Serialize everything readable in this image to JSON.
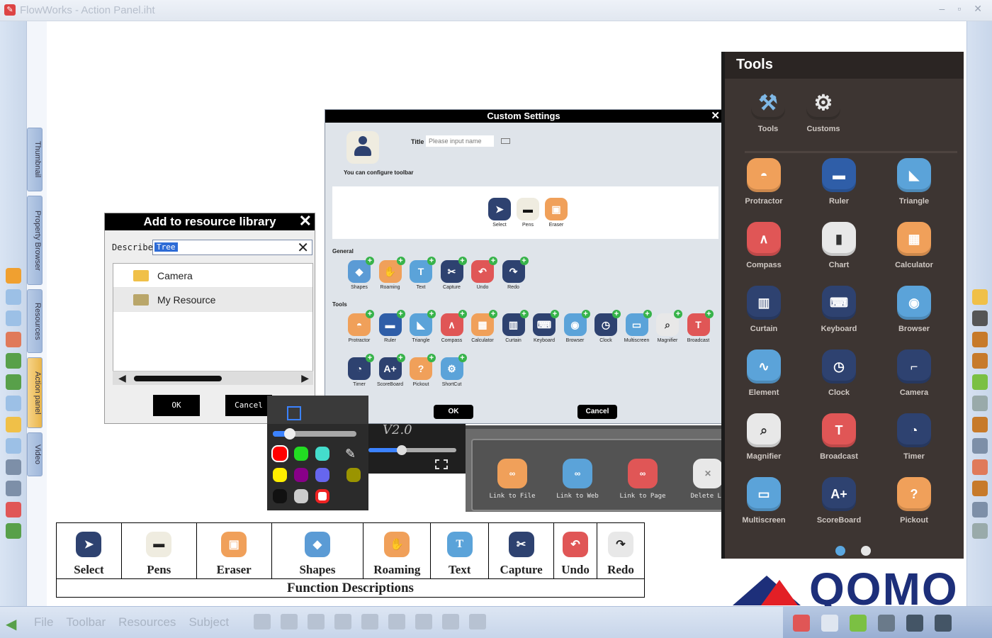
{
  "window": {
    "title": "FlowWorks - Action Panel.iht"
  },
  "left_tabs": [
    "Thumbnail",
    "Property Browser",
    "Resources",
    "Action panel",
    "Video"
  ],
  "bottom_menu": [
    "File",
    "Toolbar",
    "Resources",
    "Subject"
  ],
  "resource_dialog": {
    "title": "Add to resource library",
    "describe_label": "Describe",
    "describe_value": "Tree",
    "items": [
      "Camera",
      "My Resource"
    ],
    "ok": "OK",
    "cancel": "Cancel"
  },
  "custom_settings": {
    "title": "Custom Settings",
    "title_label": "Title",
    "title_placeholder": "Please input name",
    "hint": "You can configure toolbar",
    "preview": [
      {
        "label": "Select",
        "icon": "select-icon",
        "color": "#2e4270"
      },
      {
        "label": "Pens",
        "icon": "pens-icon",
        "color": "#efece0"
      },
      {
        "label": "Eraser",
        "icon": "eraser-icon",
        "color": "#f0a05a"
      }
    ],
    "general_label": "General",
    "general": [
      {
        "label": "Shapes",
        "icon": "shapes-icon",
        "color": "#5b9bd5"
      },
      {
        "label": "Roaming",
        "icon": "roaming-icon",
        "color": "#f0a05a"
      },
      {
        "label": "Text",
        "icon": "text-icon",
        "color": "#5ba3d9"
      },
      {
        "label": "Capture",
        "icon": "capture-icon",
        "color": "#2e4270"
      },
      {
        "label": "Undo",
        "icon": "undo-icon",
        "color": "#e05656"
      },
      {
        "label": "Redo",
        "icon": "redo-icon",
        "color": "#2e4270"
      }
    ],
    "tools_label": "Tools",
    "tools": [
      {
        "label": "Protractor",
        "icon": "protractor-icon",
        "color": "#f0a05a"
      },
      {
        "label": "Ruler",
        "icon": "ruler-icon",
        "color": "#2f5ea8"
      },
      {
        "label": "Triangle",
        "icon": "triangle-icon",
        "color": "#5ba3d9"
      },
      {
        "label": "Compass",
        "icon": "compass-icon",
        "color": "#e05656"
      },
      {
        "label": "Calculator",
        "icon": "calculator-icon",
        "color": "#f0a05a"
      },
      {
        "label": "Curtain",
        "icon": "curtain-icon",
        "color": "#2e4270"
      },
      {
        "label": "Keyboard",
        "icon": "keyboard-icon",
        "color": "#2e4270"
      },
      {
        "label": "Browser",
        "icon": "browser-icon",
        "color": "#5ba3d9"
      },
      {
        "label": "Clock",
        "icon": "clock-icon",
        "color": "#2e4270"
      },
      {
        "label": "Multiscreen",
        "icon": "multiscreen-icon",
        "color": "#5ba3d9"
      },
      {
        "label": "Magnifier",
        "icon": "magnifier-icon",
        "color": "#e8e8e8"
      },
      {
        "label": "Broadcast",
        "icon": "broadcast-icon",
        "color": "#e05656"
      },
      {
        "label": "Timer",
        "icon": "timer-icon",
        "color": "#2e4270"
      },
      {
        "label": "ScoreBoard",
        "icon": "scoreboard-icon",
        "color": "#2e4270"
      },
      {
        "label": "Pickout",
        "icon": "pickout-icon",
        "color": "#f0a05a"
      },
      {
        "label": "ShortCut",
        "icon": "shortcut-icon",
        "color": "#5ba3d9"
      }
    ],
    "ok": "OK",
    "cancel": "Cancel"
  },
  "pen_colors": [
    "#ff0000",
    "#22dd22",
    "#44ddcc",
    "#ffee00",
    "#880088",
    "#6666ee",
    "#111111",
    "#cccccc",
    "#ee2222",
    "#9a9400"
  ],
  "video_label": "V2.0",
  "link_panel": [
    {
      "label": "Link to File",
      "color": "#f0a05a"
    },
    {
      "label": "Link to Web",
      "color": "#5ba3d9"
    },
    {
      "label": "Link to Page",
      "color": "#e05656"
    },
    {
      "label": "Delete Li",
      "color": "#e8e8e8"
    }
  ],
  "tools_panel": {
    "title": "Tools",
    "top": [
      {
        "label": "Tools",
        "icon": "tools-icon",
        "color": "#3d3532"
      },
      {
        "label": "Customs",
        "icon": "customs-icon",
        "color": "#3d3532"
      }
    ],
    "grid": [
      {
        "label": "Protractor",
        "icon": "protractor-icon",
        "color": "#f0a05a"
      },
      {
        "label": "Ruler",
        "icon": "ruler-icon",
        "color": "#2f5ea8"
      },
      {
        "label": "Triangle",
        "icon": "triangle-icon",
        "color": "#5ba3d9"
      },
      {
        "label": "Compass",
        "icon": "compass-icon",
        "color": "#e05656"
      },
      {
        "label": "Chart",
        "icon": "chart-icon",
        "color": "#e8e8e8"
      },
      {
        "label": "Calculator",
        "icon": "calculator-icon",
        "color": "#f0a05a"
      },
      {
        "label": "Curtain",
        "icon": "curtain-icon",
        "color": "#2e4270"
      },
      {
        "label": "Keyboard",
        "icon": "keyboard-icon",
        "color": "#2e4270"
      },
      {
        "label": "Browser",
        "icon": "browser-icon",
        "color": "#5ba3d9"
      },
      {
        "label": "Element",
        "icon": "element-icon",
        "color": "#5ba3d9"
      },
      {
        "label": "Clock",
        "icon": "clock-icon",
        "color": "#2e4270"
      },
      {
        "label": "Camera",
        "icon": "camera-icon",
        "color": "#2e4270"
      },
      {
        "label": "Magnifier",
        "icon": "magnifier-icon",
        "color": "#e8e8e8"
      },
      {
        "label": "Broadcast",
        "icon": "broadcast-icon",
        "color": "#e05656"
      },
      {
        "label": "Timer",
        "icon": "timer-icon",
        "color": "#2e4270"
      },
      {
        "label": "Multiscreen",
        "icon": "multiscreen-icon",
        "color": "#5ba3d9"
      },
      {
        "label": "ScoreBoard",
        "icon": "scoreboard-icon",
        "color": "#2e4270"
      },
      {
        "label": "Pickout",
        "icon": "pickout-icon",
        "color": "#f0a05a"
      }
    ]
  },
  "function_table": {
    "items": [
      {
        "label": "Select",
        "color": "#2e4270"
      },
      {
        "label": "Pens",
        "color": "#efece0"
      },
      {
        "label": "Eraser",
        "color": "#f0a05a"
      },
      {
        "label": "Shapes",
        "color": "#5b9bd5"
      },
      {
        "label": "Roaming",
        "color": "#f0a05a"
      },
      {
        "label": "Text",
        "color": "#5ba3d9"
      },
      {
        "label": "Capture",
        "color": "#2e4270"
      },
      {
        "label": "Undo",
        "color": "#e05656"
      },
      {
        "label": "Redo",
        "color": "#e8e8e8"
      }
    ],
    "caption": "Function Descriptions"
  },
  "logo": {
    "text": "QOMO"
  }
}
